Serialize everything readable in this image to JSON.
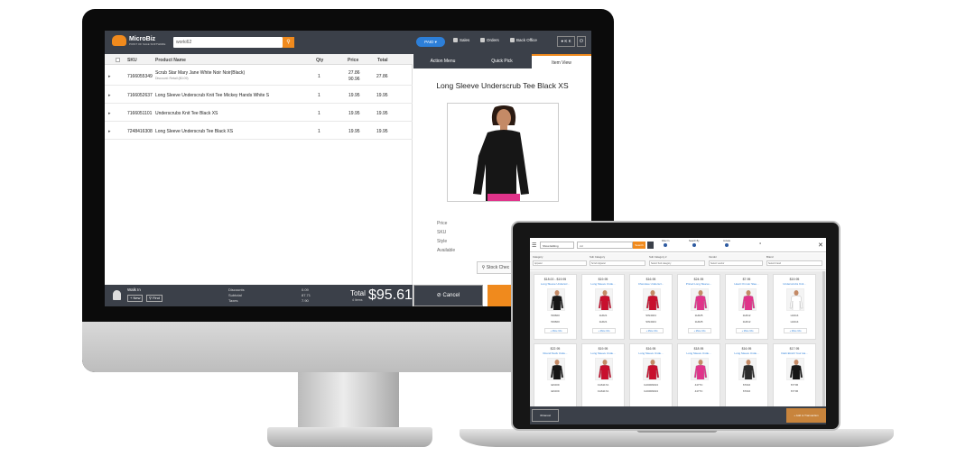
{
  "desktop": {
    "header": {
      "logo_title": "MicroBiz",
      "logo_subtitle": "POINT OF SALE SOFTWARE",
      "search_value": "worki62",
      "paid_label": "PAID",
      "nav": [
        "Sales",
        "Orders",
        "Back Office"
      ],
      "user_label": "K K"
    },
    "cart": {
      "columns": [
        "SKU",
        "Product Name",
        "Qty",
        "Price",
        "Total"
      ],
      "rows": [
        {
          "sku": "7166055349",
          "name": "Scrub Star Mary Jane White Noir Noir(Black)",
          "discount": "Discount: Retail ($0.09)",
          "qty": "1",
          "price": "27.86",
          "price2": "90.96",
          "total": "27.86"
        },
        {
          "sku": "7166052637",
          "name": "Long Sleeve Underscrub Knit Tee Mickey Hands White S",
          "qty": "1",
          "price": "19.95",
          "total": "19.95"
        },
        {
          "sku": "7166051101",
          "name": "Underscrubs Knit Tee Black XS",
          "qty": "1",
          "price": "19.95",
          "total": "19.95"
        },
        {
          "sku": "7248416308",
          "name": "Long Sleeve Underscrub Tee Black XS",
          "qty": "1",
          "price": "19.95",
          "total": "19.95"
        }
      ],
      "footer": {
        "customer": "Walk In",
        "new_label": "New",
        "find_label": "Find",
        "discounts_label": "Discounts",
        "discounts_value": "0.09",
        "subtotal_label": "Subtotal",
        "subtotal_value": "87.71",
        "taxes_label": "Taxes",
        "taxes_value": "7.90",
        "total_label": "Total",
        "items_label": "4 Items",
        "total_amount": "$95.61"
      }
    },
    "panel": {
      "tabs": [
        "Action Menu",
        "Quick Pick",
        "Item View"
      ],
      "item_title": "Long Sleeve Underscrub Tee Black XS",
      "attributes": [
        "Price",
        "SKU",
        "Style",
        "Available"
      ],
      "stock_check": "Stock Chec",
      "cancel_label": "Cancel"
    }
  },
  "laptop": {
    "mode_select": "Show Editing",
    "search_value": "xxl",
    "search_label": "Search",
    "options": [
      {
        "label": "Filter In",
        "choices": [
          "Item",
          "SKU"
        ]
      },
      {
        "label": "Search By",
        "choices": [
          "Product",
          "Sku"
        ]
      },
      {
        "label": "Include",
        "choices": [
          "In Stock",
          "All"
        ]
      }
    ],
    "filters": [
      {
        "label": "Category",
        "value": "Apparel"
      },
      {
        "label": "Sub Category",
        "value": "Scrub Apparel"
      },
      {
        "label": "Sub Category 2",
        "value": "Select Sub category"
      },
      {
        "label": "Vendor",
        "value": "Select vendor"
      },
      {
        "label": "Brand",
        "value": "Select brand"
      }
    ],
    "products_row1": [
      {
        "price": "$18.00 - $19.95",
        "name": "Long Sleeve Underscr...",
        "sku": "W9660",
        "sku2": "W9660"
      },
      {
        "price": "$19.95",
        "name": "Long Sleeve Unde...",
        "sku": "1H621",
        "sku2": "1H621"
      },
      {
        "price": "$16.95",
        "name": "Cherokee Underscr...",
        "sku": "SW4024",
        "sku2": "SW4024"
      },
      {
        "price": "$24.95",
        "name": "Priced Long Sleeve...",
        "sku": "1H625",
        "sku2": "1H625"
      },
      {
        "price": "$7.95",
        "name": "Heart On Her Slee...",
        "sku": "1H612",
        "sku2": "1H612"
      },
      {
        "price": "$19.95",
        "name": "Underscrubs Knit...",
        "sku": "HL914",
        "sku2": "HL914"
      }
    ],
    "products_row2": [
      {
        "price": "$22.95",
        "name": "Round Neck Unde...",
        "sku": "EK009",
        "sku2": "EK009"
      },
      {
        "price": "$19.95",
        "name": "Long Sleeve Unde...",
        "sku": "CA6117A",
        "sku2": "CA6117A"
      },
      {
        "price": "$16.95",
        "name": "Long Sleeve Unde...",
        "sku": "CA6009013",
        "sku2": "CA6009013"
      },
      {
        "price": "$18.95",
        "name": "Long Sleeve Unde...",
        "sku": "4477C",
        "sku2": "4477C"
      },
      {
        "price": "$16.95",
        "name": "Long Sleeve Unde...",
        "sku": "67016",
        "sku2": "67016"
      },
      {
        "price": "$17.95",
        "name": "Dark Elvish Your Ha...",
        "sku": "67736",
        "sku2": "67736"
      }
    ],
    "more_info": "More Info",
    "cancel_label": "Cancel",
    "add_label": "Add to Transaction"
  },
  "colors": {
    "accent": "#f08a1d",
    "bar": "#3b4049",
    "link": "#2d7fd8",
    "paid": "#2d7fd8"
  }
}
